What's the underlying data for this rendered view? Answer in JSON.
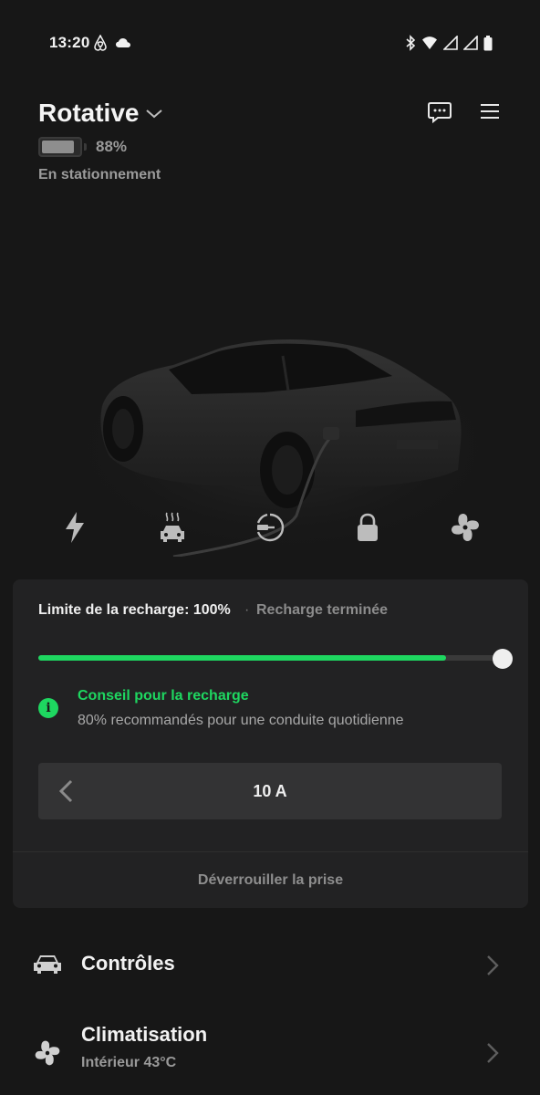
{
  "status_bar": {
    "time": "13:20",
    "left_icons": [
      "airbnb-icon",
      "cloud-icon"
    ],
    "right_icons": [
      "bluetooth-icon",
      "wifi-icon",
      "signal-icon",
      "signal-icon",
      "battery-icon"
    ]
  },
  "header": {
    "vehicle_name": "Rotative",
    "battery_percent_label": "88%",
    "battery_level": 0.88,
    "status": "En stationnement"
  },
  "quick_actions": [
    {
      "name": "charge",
      "icon": "bolt-icon"
    },
    {
      "name": "climate",
      "icon": "heated-car-icon"
    },
    {
      "name": "charge-port",
      "icon": "charge-port-icon"
    },
    {
      "name": "lock",
      "icon": "lock-icon"
    },
    {
      "name": "fan",
      "icon": "fan-icon"
    }
  ],
  "charging": {
    "limit_label": "Limite de la recharge: 100%",
    "separator": "·",
    "state": "Recharge terminée",
    "current_level": 0.88,
    "limit_level": 1.0,
    "tip_title": "Conseil pour la recharge",
    "tip_text": "80% recommandés pour une conduite quotidienne",
    "tip_icon_glyph": "i",
    "amperage": "10 A",
    "unlock_port_label": "Déverrouiller la prise"
  },
  "rows": [
    {
      "title": "Contrôles",
      "subtitle": "",
      "icon": "car-icon"
    },
    {
      "title": "Climatisation",
      "subtitle": "Intérieur 43°C",
      "icon": "fan-icon"
    }
  ],
  "colors": {
    "background": "#171717",
    "card": "#222223",
    "accent_green": "#1ed760",
    "text_primary": "#f2f2f2",
    "text_secondary": "#9a9a9a"
  }
}
